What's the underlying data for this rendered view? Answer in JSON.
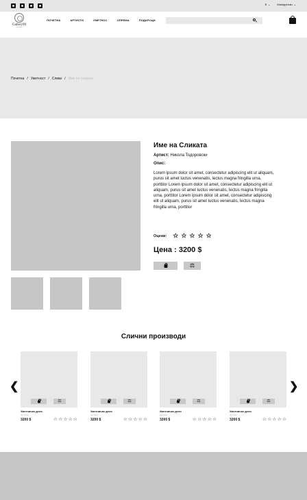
{
  "topbar": {
    "social_icons": [
      "instagram-icon",
      "facebook-icon",
      "twitter-icon",
      "youtube-icon"
    ],
    "currency": "$",
    "language": "Македонски"
  },
  "header": {
    "logo_text": "Gallery99",
    "logo_sub": "art gallery",
    "nav": [
      "ПОЧЕТНА",
      "АРТИСТИ",
      "УМЕТНОС",
      "ОПРЕМА",
      "ПОДАРОЦИ"
    ],
    "search_placeholder": ""
  },
  "breadcrumb": [
    "Почетна",
    "Уметност",
    "Слики",
    "Име на сликата"
  ],
  "product": {
    "title": "Име на Сликата",
    "artist_label": "Артист:",
    "artist_name": "Никола Тодоровски",
    "description_label": "Опис:",
    "description": "Lorem ipsum dolor sit amet, consectetur adipiscing elit ut aliquam, purus sit amet luctus venenatis, lectus magna fringilla urna, porttitor Lorem ipsum dolor sit amet, consectetur adipiscing elit ut aliquam, purus sit amet luctus venenatis, lectus magna fringilla urna, porttitor Lorem ipsum dolor sit amet, consectetur adipiscing elit ut aliquam, purus sit amet luctus venenatis, lectus magna fringilla urna, porttitor",
    "rating_label": "Оцени:",
    "rating_value": 0,
    "rating_max": 5,
    "price": "Цена : 3200 $"
  },
  "similar": {
    "title": "Слични производи",
    "cards": [
      {
        "name": "Уметничко дело",
        "artist": "Артист",
        "price": "3200 $"
      },
      {
        "name": "Уметничко дело",
        "artist": "Артист",
        "price": "3200 $"
      },
      {
        "name": "Уметничко дело",
        "artist": "Артист",
        "price": "3200 $"
      },
      {
        "name": "Уметничко дело",
        "artist": "Артист",
        "price": "3200 $"
      }
    ]
  },
  "glyphs": {
    "star": "☆",
    "scale": "⚖",
    "arrow_left": "❮",
    "arrow_right": "❯",
    "chevron": "⌄"
  }
}
